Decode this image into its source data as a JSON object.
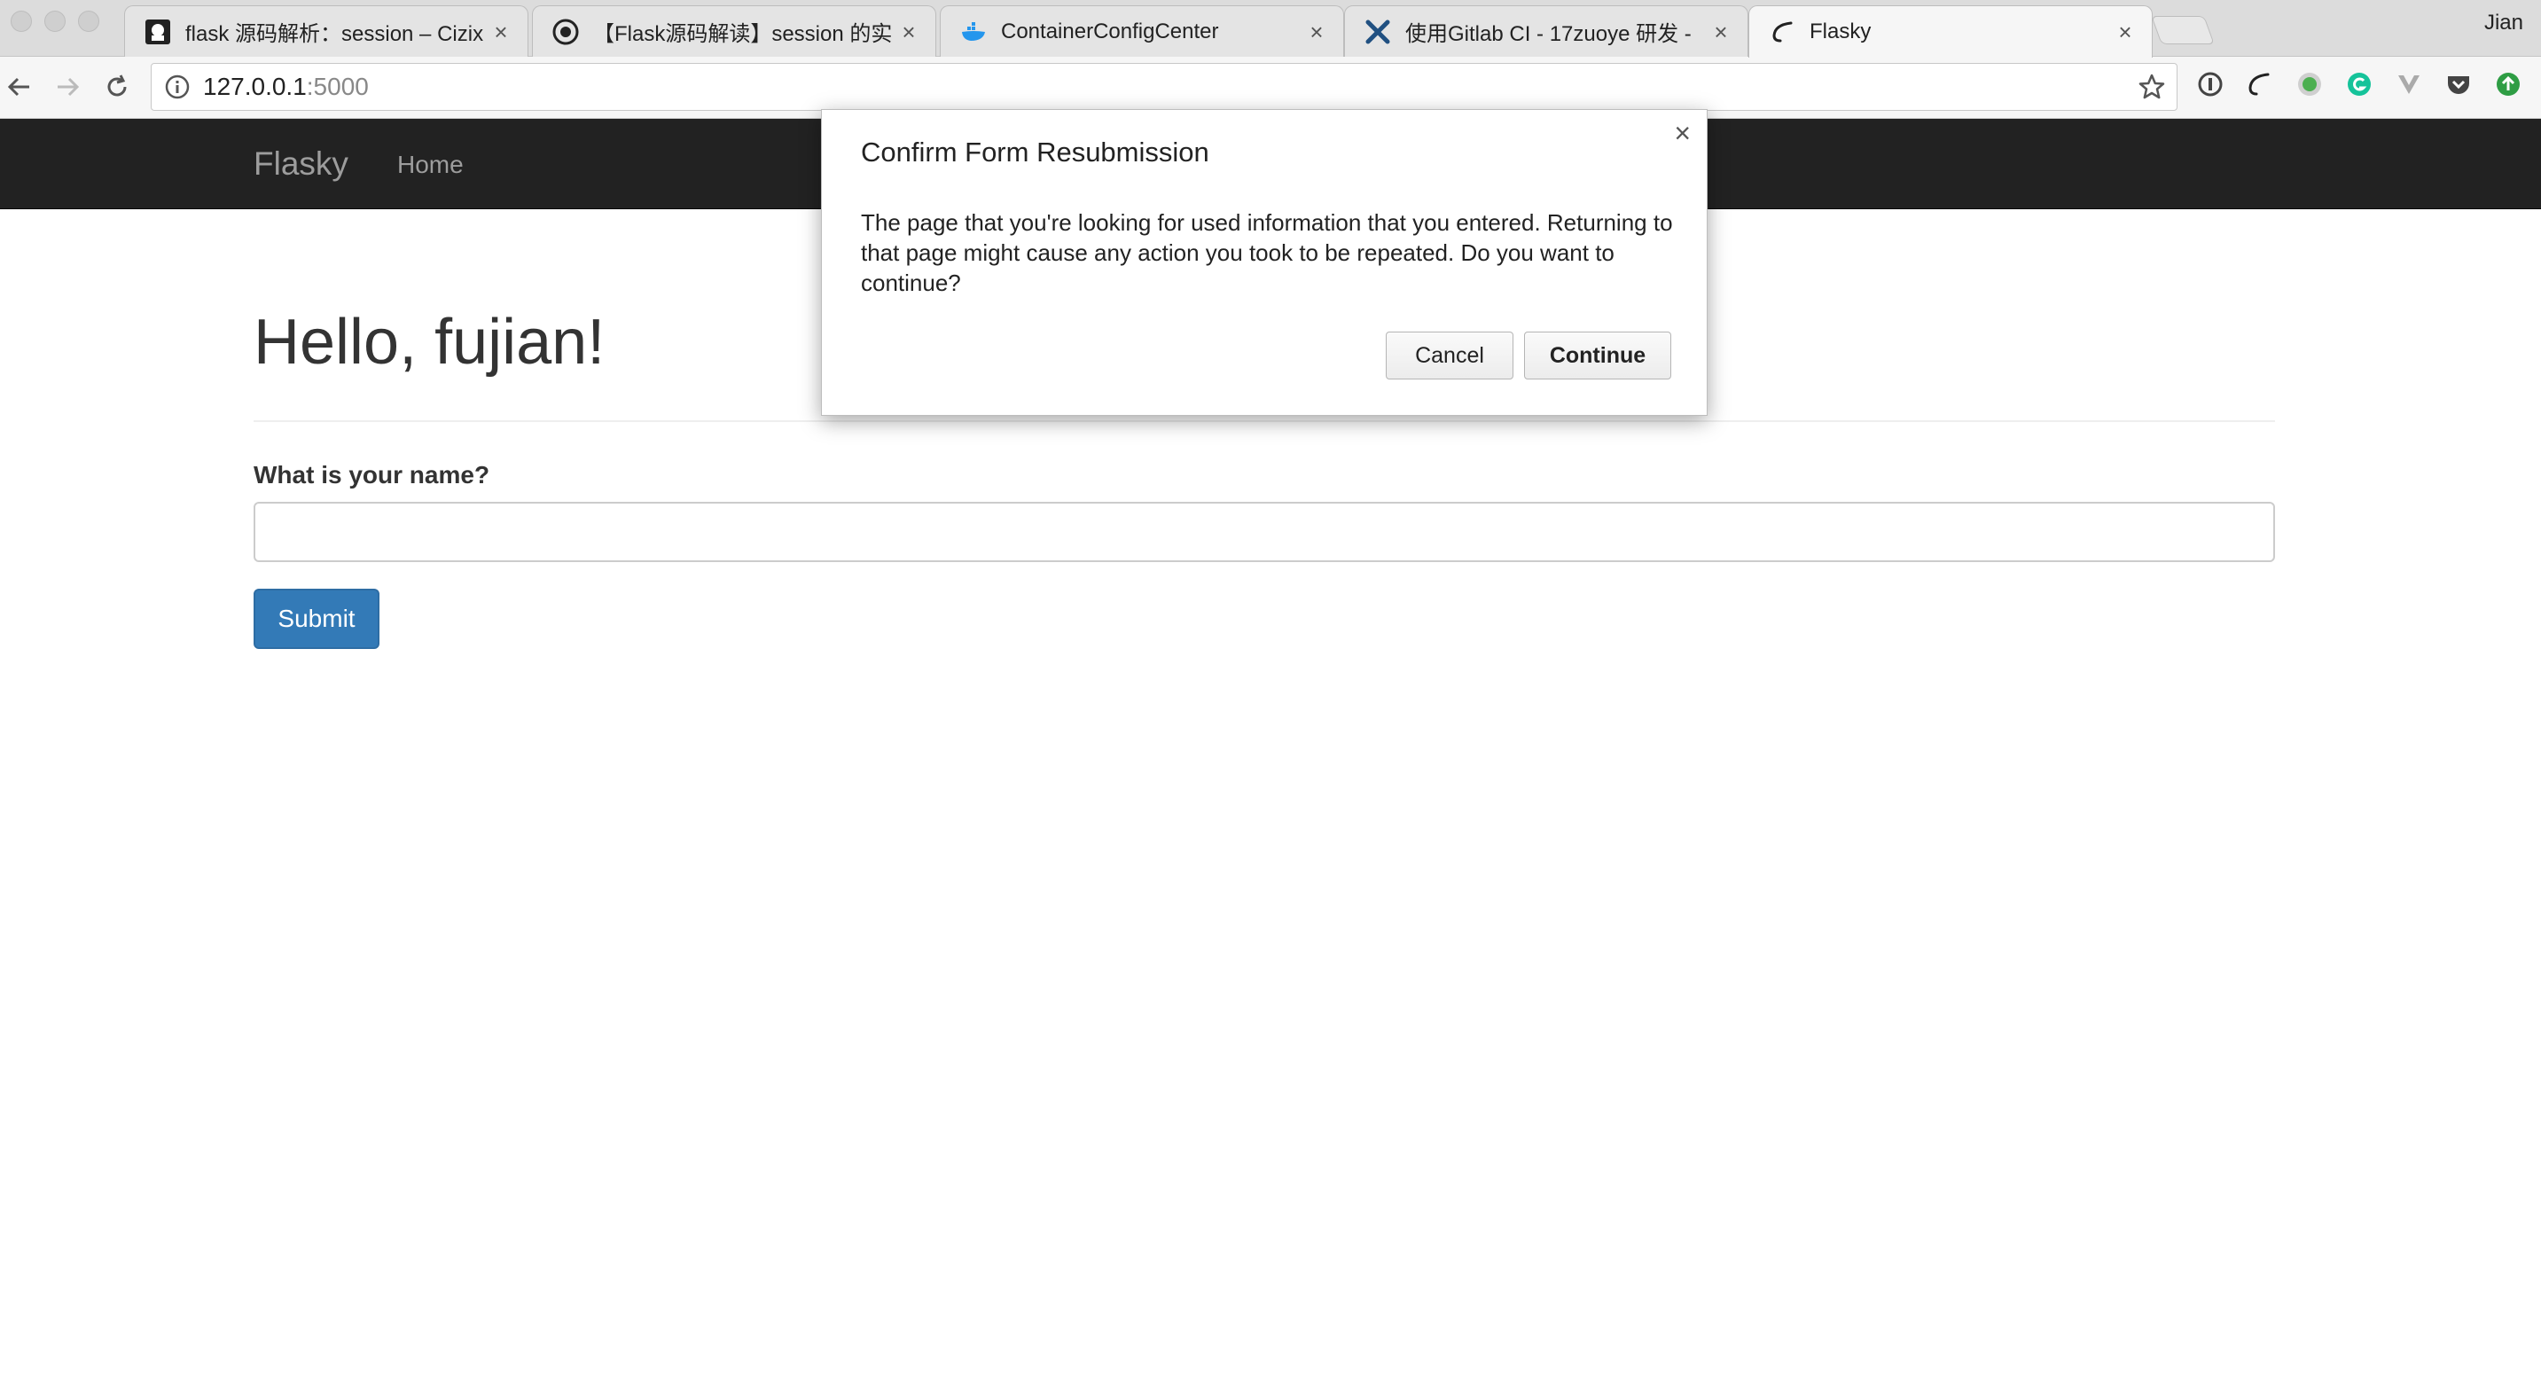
{
  "browser": {
    "profile_name": "Jian",
    "tabs": [
      {
        "title": "flask 源码解析：session – Cizix",
        "icon": "github-avatar-icon"
      },
      {
        "title": "【Flask源码解读】session 的实",
        "icon": "cat-avatar-icon"
      },
      {
        "title": "ContainerConfigCenter",
        "icon": "docker-whale-icon"
      },
      {
        "title": "使用Gitlab CI - 17zuoye 研发 - ",
        "icon": "confluence-x-icon"
      },
      {
        "title": "Flasky",
        "icon": "flask-horn-icon"
      }
    ],
    "active_tab": 4,
    "url_host": "127.0.0.1",
    "url_port": ":5000",
    "extensions": [
      "onepassword-icon",
      "flask-horn-icon",
      "green-dot-icon",
      "grammarly-icon",
      "vue-devtools-icon",
      "pocket-icon",
      "upload-icon"
    ]
  },
  "page": {
    "brand": "Flasky",
    "nav_home": "Home",
    "heading": "Hello, fujian!",
    "form_label": "What is your name?",
    "name_value": "",
    "submit_label": "Submit"
  },
  "dialog": {
    "title": "Confirm Form Resubmission",
    "body": "The page that you're looking for used information that you entered. Returning to that page might cause any action you took to be repeated. Do you want to continue?",
    "cancel_label": "Cancel",
    "continue_label": "Continue",
    "close_glyph": "×"
  },
  "colors": {
    "navbar_bg": "#222222",
    "navbar_text": "#9d9d9d",
    "primary_button": "#337ab7"
  }
}
